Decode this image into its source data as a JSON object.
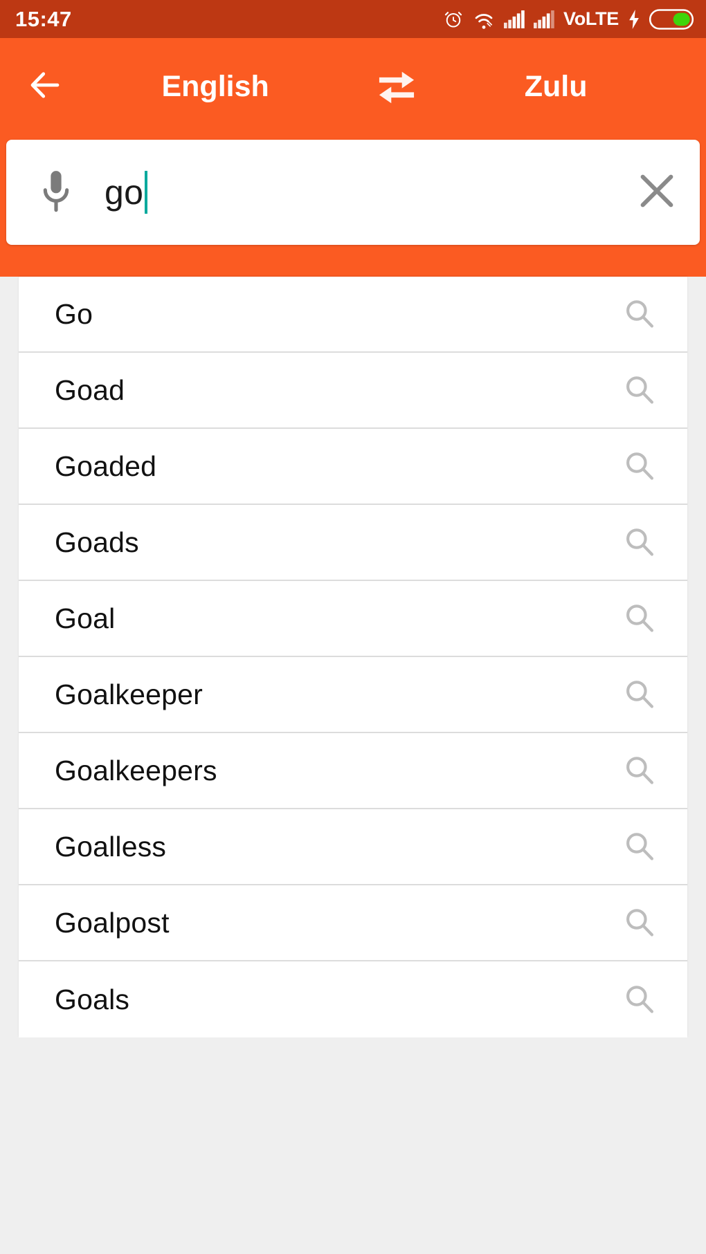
{
  "status_bar": {
    "time": "15:47",
    "volte_label": "VoLTE",
    "background_color": "#BD3813",
    "icons": [
      "alarm-clock-icon",
      "wifi-icon",
      "signal-bars-sim1-icon",
      "signal-bars-sim2-icon",
      "volte-label",
      "charging-bolt-icon",
      "battery-icon"
    ],
    "battery_color": "#3FD40B"
  },
  "app_bar": {
    "background_color": "#FB5B22",
    "back_label": "back-arrow",
    "source_language": "English",
    "swap_label": "swap-languages",
    "target_language": "Zulu"
  },
  "search": {
    "value": "go",
    "placeholder": "",
    "mic_label": "voice-input",
    "clear_label": "clear-text",
    "caret_color": "#00A99D"
  },
  "suggestions": {
    "items": [
      {
        "word": "Go"
      },
      {
        "word": "Goad"
      },
      {
        "word": "Goaded"
      },
      {
        "word": "Goads"
      },
      {
        "word": "Goal"
      },
      {
        "word": "Goalkeeper"
      },
      {
        "word": "Goalkeepers"
      },
      {
        "word": "Goalless"
      },
      {
        "word": "Goalpost"
      },
      {
        "word": "Goals"
      }
    ],
    "row_icon": "search-icon"
  },
  "page": {
    "background_color": "#EFEFEF"
  }
}
